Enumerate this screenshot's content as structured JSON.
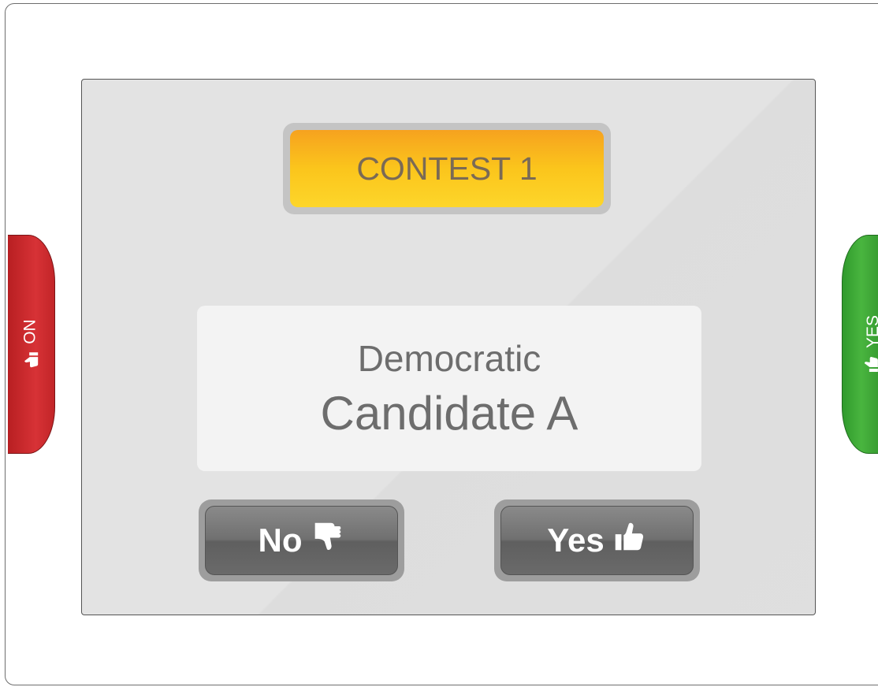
{
  "side_tabs": {
    "no_label": "NO",
    "yes_label": "YES"
  },
  "contest": {
    "title": "CONTEST 1"
  },
  "candidate": {
    "party": "Democratic",
    "name": "Candidate A"
  },
  "buttons": {
    "no_label": "No",
    "yes_label": "Yes"
  },
  "colors": {
    "no_accent": "#d73236",
    "yes_accent": "#49b53f",
    "contest_accent": "#fbc51c"
  },
  "icons": {
    "no": "thumbs-down-icon",
    "yes": "thumbs-up-icon"
  }
}
